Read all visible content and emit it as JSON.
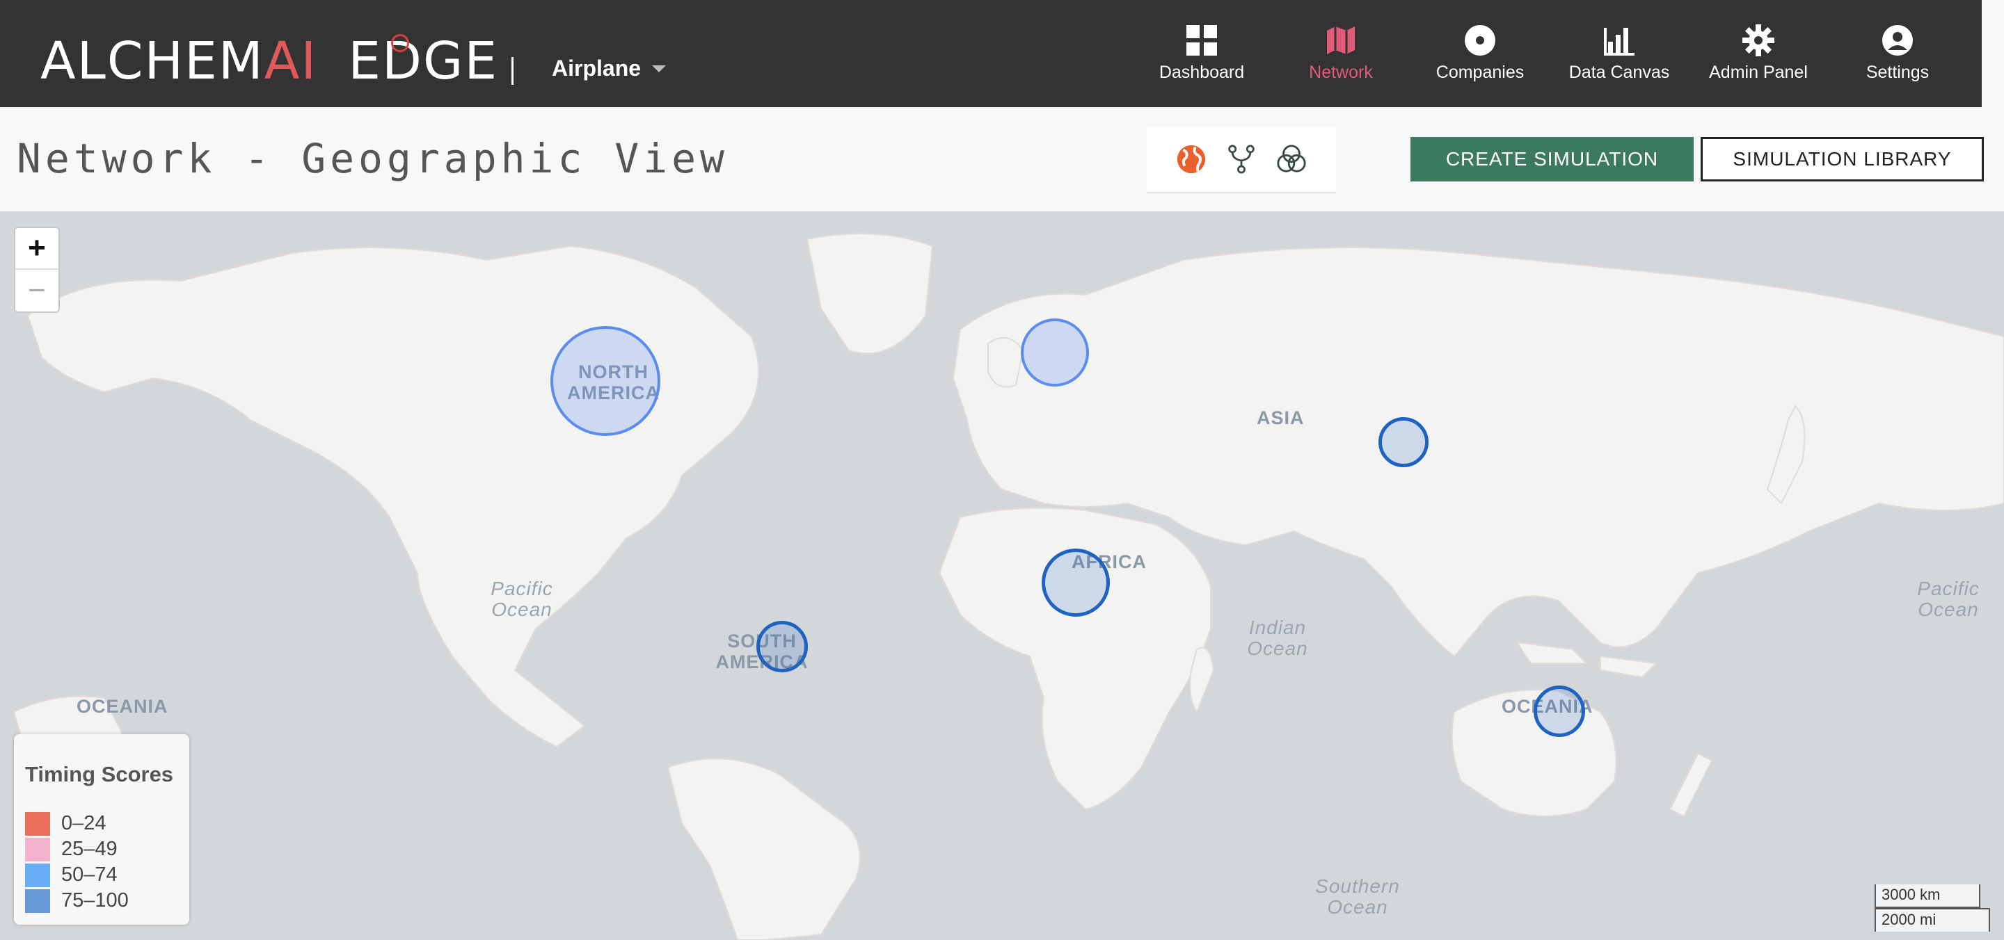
{
  "app": {
    "logo": {
      "part1": "ALCHEM",
      "part2": "AI",
      "part3": "EDGE"
    },
    "project": "Airplane"
  },
  "nav": {
    "items": [
      {
        "label": "Dashboard",
        "icon": "grid-icon"
      },
      {
        "label": "Network",
        "icon": "map-icon",
        "active": true
      },
      {
        "label": "Companies",
        "icon": "disc-icon"
      },
      {
        "label": "Data Canvas",
        "icon": "bar-chart-icon"
      },
      {
        "label": "Admin Panel",
        "icon": "gear-icon"
      },
      {
        "label": "Settings",
        "icon": "user-circle-icon"
      }
    ],
    "active_color": "#e05a7a"
  },
  "page": {
    "title": "Network - Geographic View",
    "view_switch": [
      "globe-icon",
      "fork-icon",
      "venn-icon"
    ],
    "create_button": "CREATE SIMULATION",
    "library_button": "SIMULATION LIBRARY"
  },
  "map": {
    "continents": {
      "north_america": "NORTH AMERICA",
      "south_america": "SOUTH AMERICA",
      "africa": "AFRICA",
      "asia": "ASIA",
      "oceania_west": "OCEANIA",
      "oceania_east": "OCEANIA"
    },
    "oceans": {
      "pacific_west": "Pacific Ocean",
      "pacific_east": "Pacific Ocean",
      "indian": "Indian Ocean",
      "southern": "Southern Ocean"
    },
    "zoom_in": "+",
    "zoom_out": "−",
    "scale": {
      "km": "3000 km",
      "mi": "2000 mi"
    }
  },
  "legend": {
    "title": "Timing Scores",
    "items": [
      {
        "label": "0–24",
        "color": "#e8705a"
      },
      {
        "label": "25–49",
        "color": "#f2b3cc"
      },
      {
        "label": "50–74",
        "color": "#6aacf5"
      },
      {
        "label": "75–100",
        "color": "#6698d6"
      }
    ]
  },
  "colors": {
    "topbar": "#333333",
    "create_button": "#3c7a60",
    "marker_light": "#5b8cf0",
    "marker_dark": "#1f63c0"
  }
}
